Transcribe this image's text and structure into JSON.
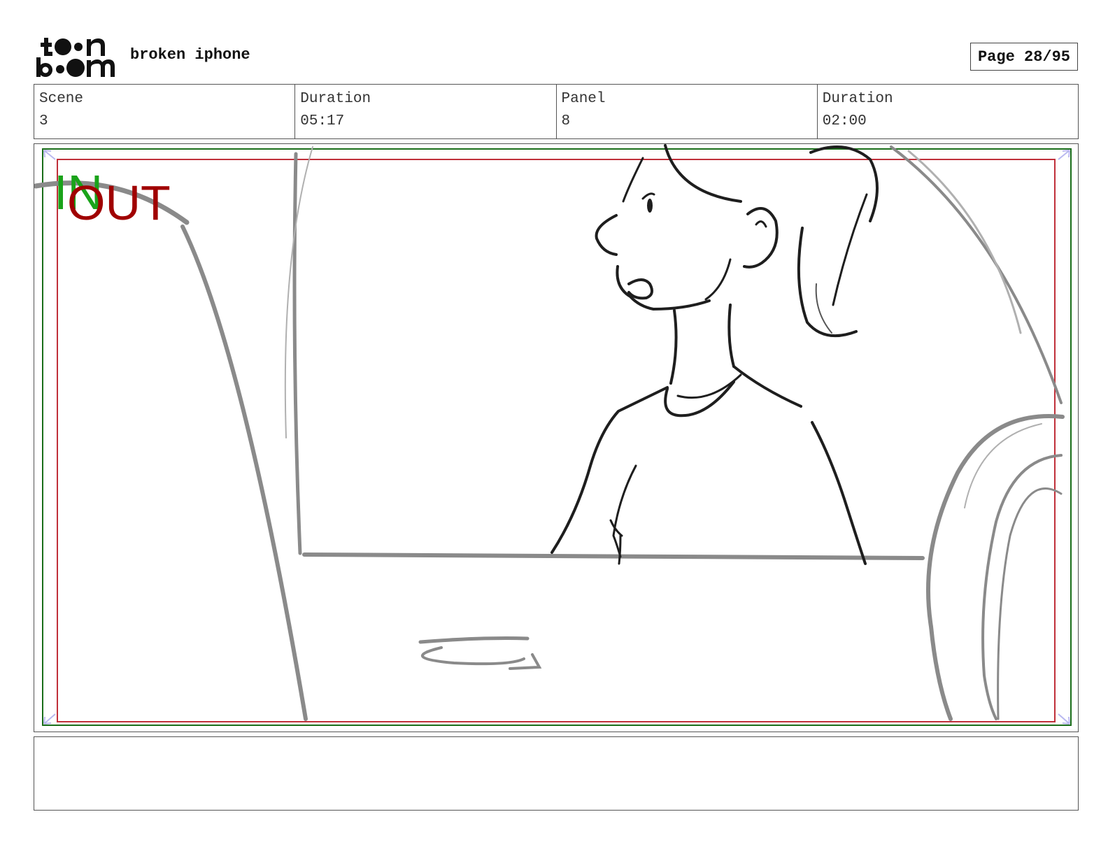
{
  "header": {
    "logo_text": "toonboom",
    "project_title": "broken iphone",
    "page_indicator": "Page 28/95"
  },
  "info": {
    "scene_label": "Scene",
    "scene_value": "3",
    "scene_duration_label": "Duration",
    "scene_duration_value": "05:17",
    "panel_label": "Panel",
    "panel_value": "8",
    "panel_duration_label": "Duration",
    "panel_duration_value": "02:00"
  },
  "panel": {
    "in_marker": "IN",
    "out_marker": "OUT",
    "in_color": "#1aa31a",
    "out_color": "#a00000",
    "safe_frame_color": "#1a6e1a",
    "title_frame_color": "#c0303a"
  },
  "notes": {
    "text": ""
  }
}
